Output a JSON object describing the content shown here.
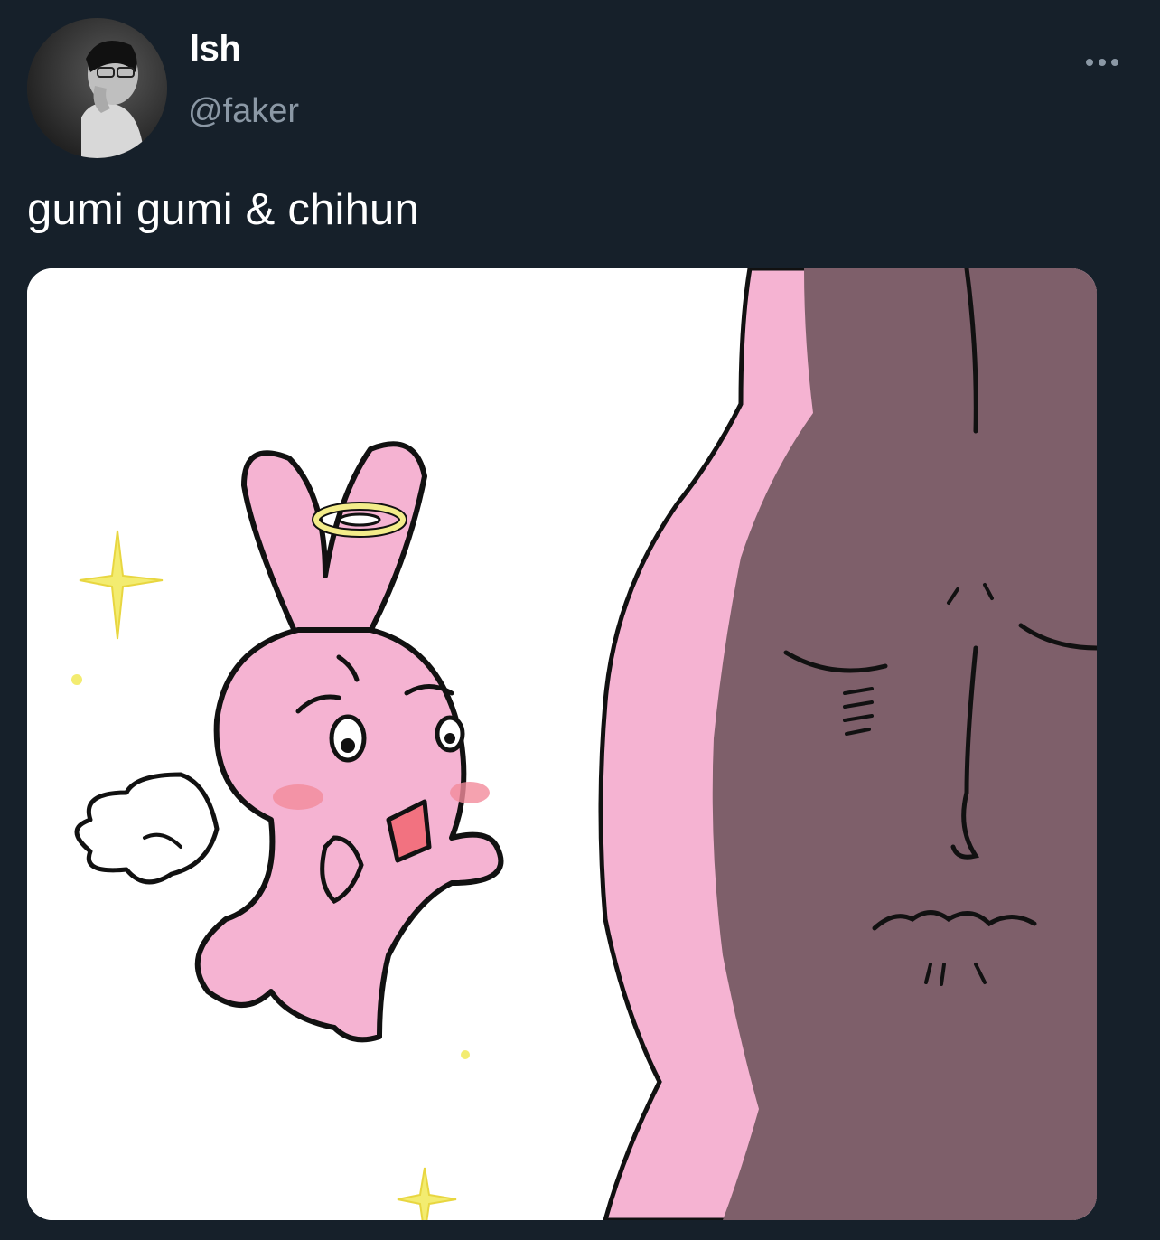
{
  "author": {
    "display_name": "lsh",
    "handle": "@faker",
    "avatar_icon": "profile-photo"
  },
  "tweet": {
    "text": "gumi gumi & chihun"
  },
  "more_menu": {
    "icon": "more-horizontal-icon"
  },
  "media": {
    "description_icon": "cartoon-rabbit-illustration"
  },
  "colors": {
    "background": "#16202a",
    "text_primary": "#ffffff",
    "text_secondary": "#8b98a5",
    "rabbit_pink": "#f5b3d2",
    "rabbit_shadow": "#7e5f6a",
    "halo_yellow": "#f3ec8a"
  }
}
